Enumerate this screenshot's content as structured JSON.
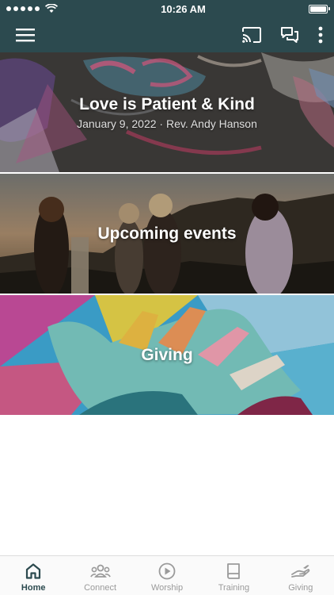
{
  "status": {
    "time": "10:26 AM"
  },
  "colors": {
    "header": "#2c4a4f",
    "tab_active": "#2c4a4f",
    "tab_inactive": "#9a9a9a"
  },
  "appbar": {
    "icons": [
      "menu-icon",
      "cast-icon",
      "chat-icon",
      "more-vert-icon"
    ]
  },
  "cards": [
    {
      "title": "Love is Patient & Kind",
      "subtitle": "January 9, 2022 · Rev. Andy Hanson"
    },
    {
      "title": "Upcoming events"
    },
    {
      "title": "Giving"
    }
  ],
  "tabs": [
    {
      "label": "Home",
      "icon": "home-icon",
      "active": true
    },
    {
      "label": "Connect",
      "icon": "people-icon",
      "active": false
    },
    {
      "label": "Worship",
      "icon": "play-icon",
      "active": false
    },
    {
      "label": "Training",
      "icon": "book-icon",
      "active": false
    },
    {
      "label": "Giving",
      "icon": "giving-hand-icon",
      "active": false
    }
  ]
}
